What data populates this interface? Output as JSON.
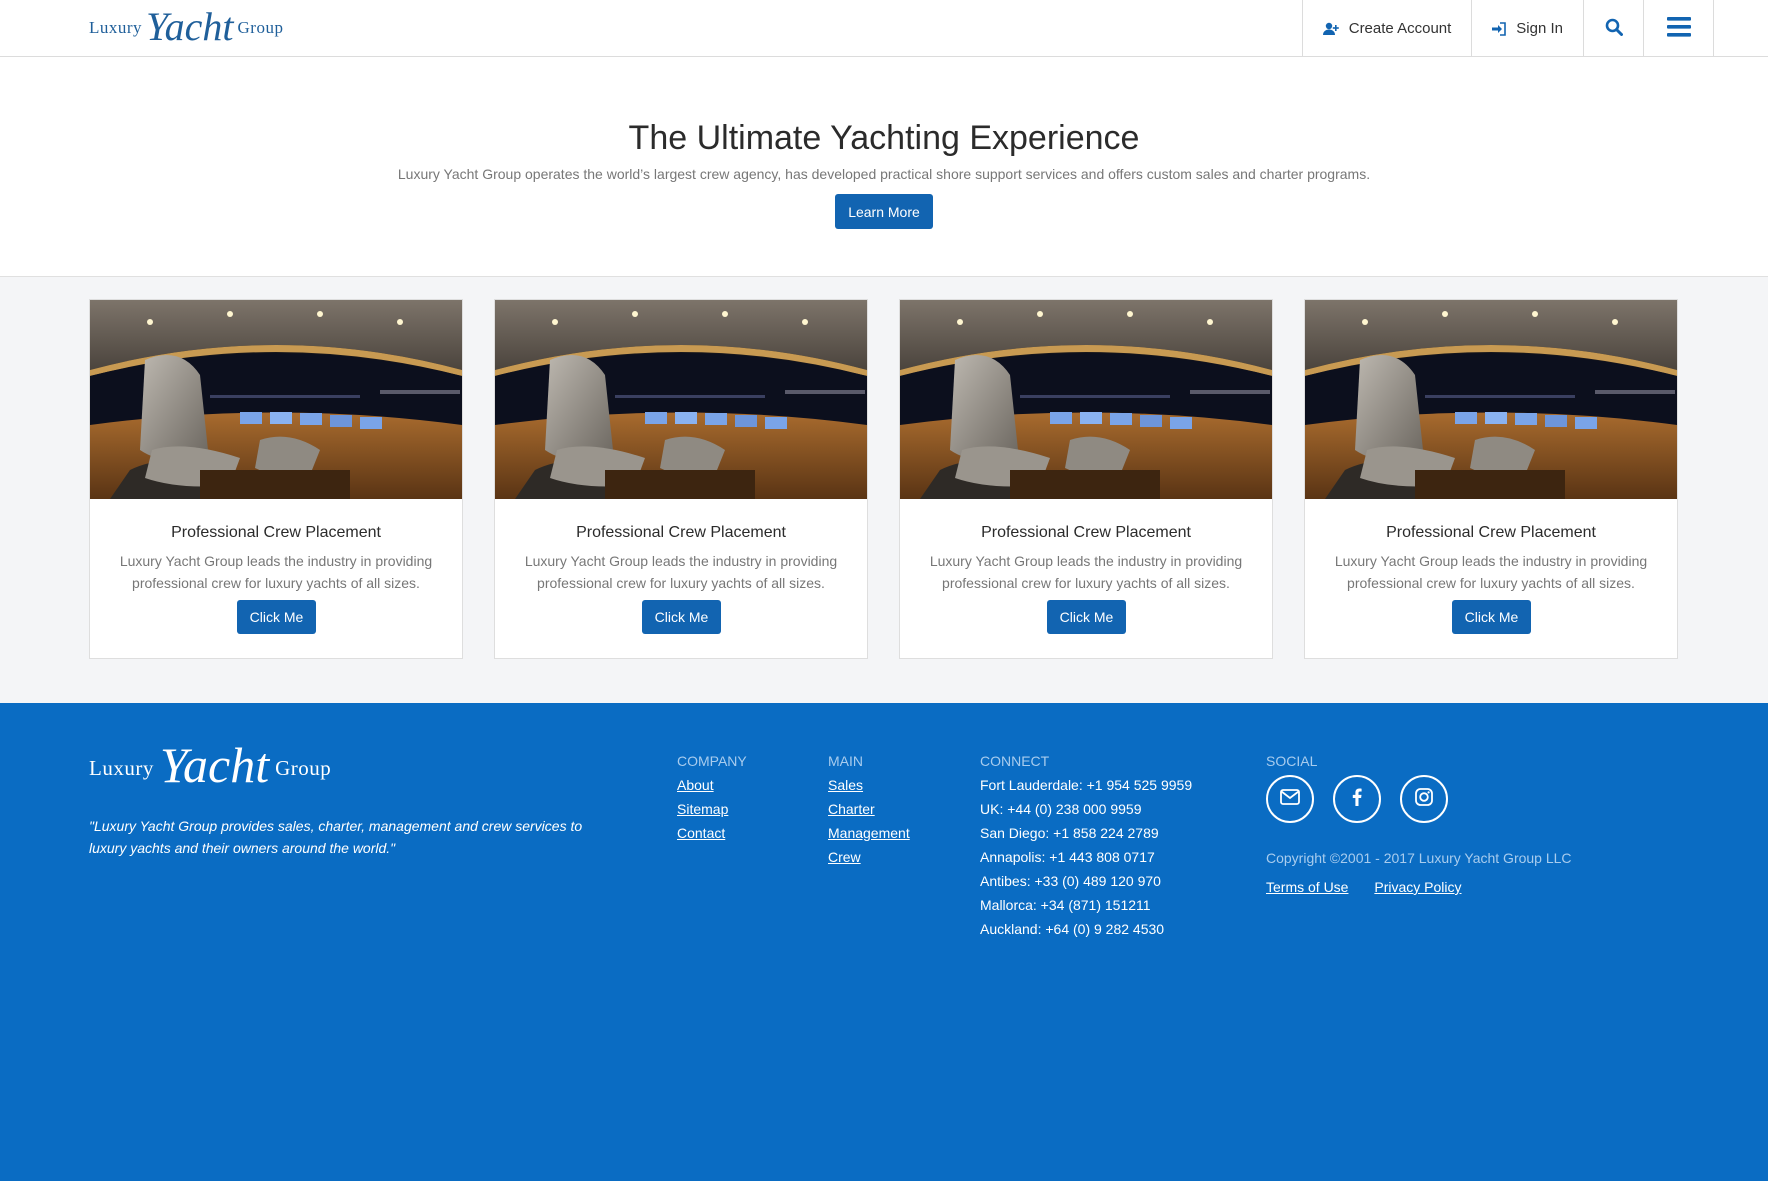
{
  "header": {
    "logo": {
      "left": "Luxury",
      "script": "Yacht",
      "right": "Group"
    },
    "create_account": "Create Account",
    "sign_in": "Sign In"
  },
  "hero": {
    "title": "The Ultimate Yachting Experience",
    "subtitle": "Luxury Yacht Group operates the world’s largest crew agency, has developed practical shore support services and offers custom sales and charter programs.",
    "button": "Learn More"
  },
  "cards": [
    {
      "title": "Professional Crew Placement",
      "text": "Luxury Yacht Group leads the industry in providing professional crew for luxury yachts of all sizes.",
      "button": "Click Me"
    },
    {
      "title": "Professional Crew Placement",
      "text": "Luxury Yacht Group leads the industry in providing professional crew for luxury yachts of all sizes.",
      "button": "Click Me"
    },
    {
      "title": "Professional Crew Placement",
      "text": "Luxury Yacht Group leads the industry in providing professional crew for luxury yachts of all sizes.",
      "button": "Click Me"
    },
    {
      "title": "Professional Crew Placement",
      "text": "Luxury Yacht Group leads the industry in providing professional crew for luxury yachts of all sizes.",
      "button": "Click Me"
    }
  ],
  "footer": {
    "logo": {
      "left": "Luxury",
      "script": "Yacht",
      "right": "Group"
    },
    "quote": "\"Luxury Yacht Group provides sales, charter, management and crew services to luxury yachts and their owners around the world.\"",
    "company": {
      "heading": "COMPANY",
      "links": [
        "About",
        "Sitemap",
        "Contact"
      ]
    },
    "main": {
      "heading": "MAIN",
      "links": [
        "Sales",
        "Charter",
        "Management",
        "Crew"
      ]
    },
    "connect": {
      "heading": "CONNECT",
      "lines": [
        "Fort Lauderdale: +1 954 525 9959",
        "UK: +44 (0) 238 000 9959",
        "San Diego: +1 858 224 2789",
        "Annapolis: +1 443 808 0717",
        "Antibes: +33 (0) 489 120 970",
        "Mallorca: +34 (871) 151211",
        "Auckland: +64 (0) 9 282 4530"
      ]
    },
    "social": {
      "heading": "SOCIAL",
      "icons": [
        "envelope-icon",
        "facebook-icon",
        "instagram-icon"
      ]
    },
    "copyright": "Copyright ©2001 - 2017 Luxury Yacht Group LLC",
    "terms": "Terms of Use",
    "privacy": "Privacy Policy"
  },
  "colors": {
    "brand_blue": "#1264b1",
    "footer_blue": "#0a6cc3"
  }
}
